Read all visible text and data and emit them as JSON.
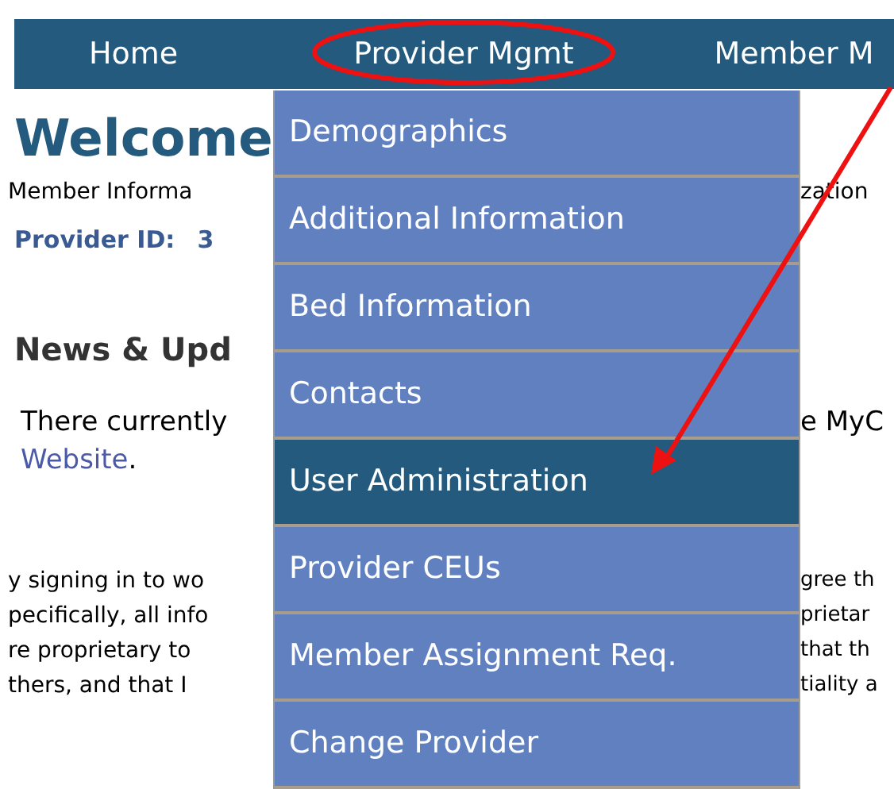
{
  "nav": [
    {
      "label": "Home"
    },
    {
      "label": "Provider Mgmt"
    },
    {
      "label": "Member M"
    }
  ],
  "page": {
    "welcome": "Welcome",
    "subtitle_left": "Member Informa",
    "subtitle_right": "zation",
    "provider_id_label": "Provider ID:",
    "provider_id_value": "3",
    "news_heading": "News & Upd",
    "news_text_left": "There currently",
    "news_text_right": "e MyC",
    "news_link": "Website",
    "news_link_suffix": ".",
    "disclaimer": [
      {
        "left": "y signing in to wo",
        "right": "gree th"
      },
      {
        "left": "pecifically, all info",
        "right": "prietar"
      },
      {
        "left": "re proprietary to",
        "right": "that th"
      },
      {
        "left": "thers, and that I",
        "right": "tiality a"
      }
    ]
  },
  "menu": [
    {
      "label": "Demographics",
      "selected": false
    },
    {
      "label": "Additional Information",
      "selected": false
    },
    {
      "label": "Bed Information",
      "selected": false
    },
    {
      "label": "Contacts",
      "selected": false
    },
    {
      "label": "User Administration",
      "selected": true
    },
    {
      "label": "Provider CEUs",
      "selected": false
    },
    {
      "label": "Member Assignment Req.",
      "selected": false
    },
    {
      "label": "Change Provider",
      "selected": false
    }
  ]
}
